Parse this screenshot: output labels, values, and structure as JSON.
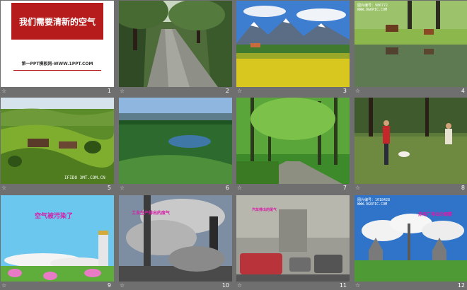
{
  "slides": [
    {
      "num": "1",
      "title": "我们需要清新的空气",
      "subtitle": "第一PPT模板网-WWW.1PPT.COM"
    },
    {
      "num": "2"
    },
    {
      "num": "3"
    },
    {
      "num": "4",
      "watermark_line1": "图片编号：986772",
      "watermark_line2": "WWW.OGOPIC.COM"
    },
    {
      "num": "5",
      "watermark": "IFIDO 3MT.COM.CN"
    },
    {
      "num": "6"
    },
    {
      "num": "7"
    },
    {
      "num": "8"
    },
    {
      "num": "9",
      "caption": "空气被污染了"
    },
    {
      "num": "10",
      "caption": "工业生产排出的废气"
    },
    {
      "num": "11",
      "caption": "汽车排出的尾气"
    },
    {
      "num": "12",
      "caption": "热电厂排出的烟雾",
      "watermark_line1": "图片编号：1018428",
      "watermark_line2": "WWW.OGOPIC.COM"
    }
  ],
  "slide_marker": "☆",
  "colors": {
    "background": "#6f6f6f",
    "title_red": "#b71c1c",
    "caption_magenta": "#d81ba8"
  }
}
